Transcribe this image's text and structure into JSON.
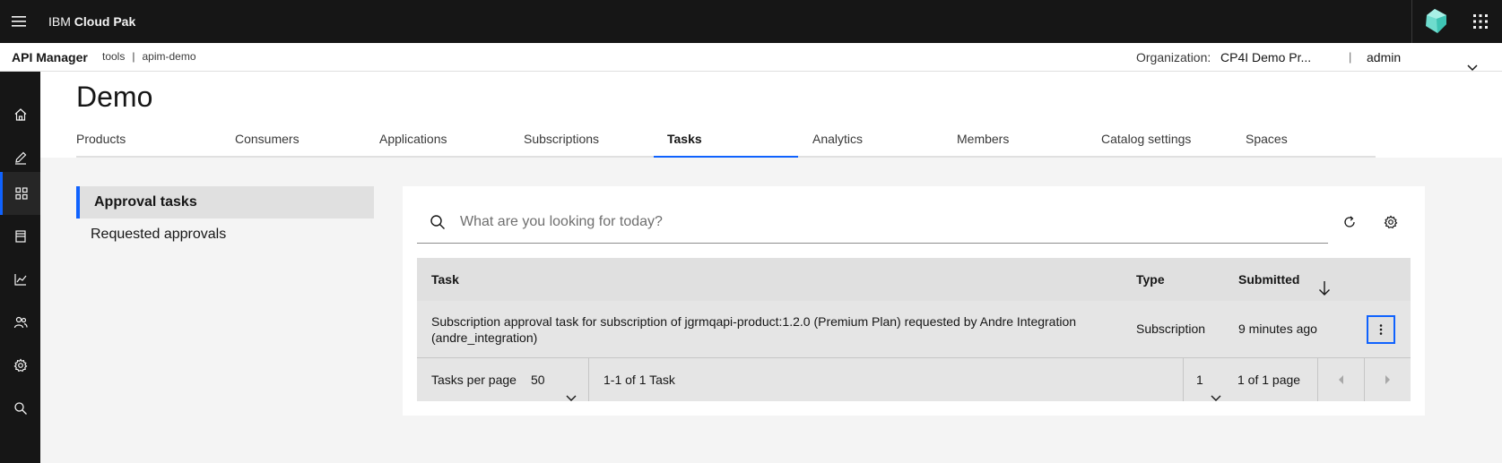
{
  "header": {
    "brand_prefix": "IBM",
    "brand_name": "Cloud Pak"
  },
  "subheader": {
    "product": "API Manager",
    "breadcrumb": [
      "tools",
      "apim-demo"
    ],
    "breadcrumb_sep": "|",
    "org_label": "Organization:",
    "org_value": "CP4I Demo Pr...",
    "separator": "|",
    "user": "admin"
  },
  "sidenav": {
    "icons": [
      "home-icon",
      "edit-icon",
      "catalog-icon",
      "document-icon",
      "analytics-icon",
      "members-icon",
      "settings-icon",
      "search-icon"
    ],
    "active": "catalog-icon"
  },
  "page": {
    "title": "Demo",
    "tabs": [
      {
        "label": "Products"
      },
      {
        "label": "Consumers"
      },
      {
        "label": "Applications"
      },
      {
        "label": "Subscriptions"
      },
      {
        "label": "Tasks"
      },
      {
        "label": "Analytics"
      },
      {
        "label": "Members"
      },
      {
        "label": "Catalog settings"
      },
      {
        "label": "Spaces"
      }
    ],
    "active_tab": "Tasks"
  },
  "subnav": {
    "items": [
      {
        "label": "Approval tasks"
      },
      {
        "label": "Requested approvals"
      }
    ]
  },
  "table": {
    "search_placeholder": "What are you looking for today?",
    "columns": {
      "task": "Task",
      "type": "Type",
      "submitted": "Submitted"
    },
    "rows": [
      {
        "task": "Subscription approval task for subscription of jgrmqapi-product:1.2.0 (Premium Plan) requested by Andre Integration (andre_integration)",
        "type": "Subscription",
        "submitted": "9 minutes ago"
      }
    ],
    "pagination": {
      "per_page_label": "Tasks per page",
      "per_page_value": "50",
      "range": "1-1 of 1 Task",
      "page_value": "1",
      "page_total": "1 of 1 page"
    }
  },
  "colors": {
    "accent": "#0f62fe",
    "header_bg": "#161616",
    "logo": "#6fdcce"
  }
}
